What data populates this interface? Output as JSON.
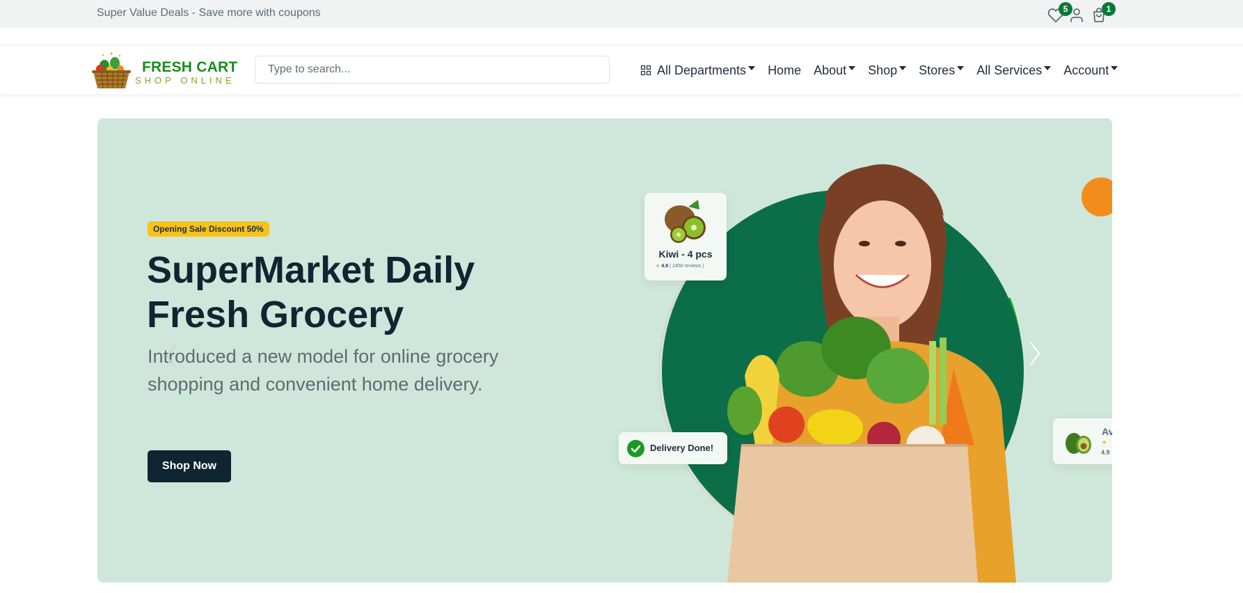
{
  "topbar": {
    "promo_text": "Super Value Deals - Save more with coupons",
    "wishlist_icon": "heart-icon",
    "wishlist_count": "5",
    "account_icon": "user-icon",
    "cart_icon": "shopping-bag-icon",
    "cart_count": "1"
  },
  "header": {
    "logo_title": "FRESH CART",
    "logo_subtitle": "SHOP ONLINE",
    "search_placeholder": "Type to search...",
    "nav": [
      {
        "label": "All Departments",
        "icon": "grid-icon",
        "dropdown": true
      },
      {
        "label": "Home",
        "dropdown": false
      },
      {
        "label": "About",
        "dropdown": true
      },
      {
        "label": "Shop",
        "dropdown": true
      },
      {
        "label": "Stores",
        "dropdown": true
      },
      {
        "label": "All Services",
        "dropdown": true
      },
      {
        "label": "Account",
        "dropdown": true
      }
    ]
  },
  "hero": {
    "badge": "Opening Sale Discount 50%",
    "title": "SuperMarket Daily Fresh Grocery",
    "description": "Introduced a new model for online grocery shopping and convenient home delivery.",
    "button": "Shop Now",
    "prev_icon": "chevron-left-icon",
    "next_icon": "chevron-right-icon",
    "kiwi_card": {
      "title": "Kiwi - 4 pcs",
      "rating": "4.9",
      "reviews": "( 2450 reviews )"
    },
    "delivery_card": {
      "text": "Delivery Done!"
    },
    "avocado_card": {
      "title": "Av",
      "rating": "4.9"
    }
  },
  "colors": {
    "brand_green": "#0a7a3b",
    "hero_bg": "#cfe7da",
    "badge_yellow": "#f7c21b",
    "dark_navy": "#0f2532"
  }
}
